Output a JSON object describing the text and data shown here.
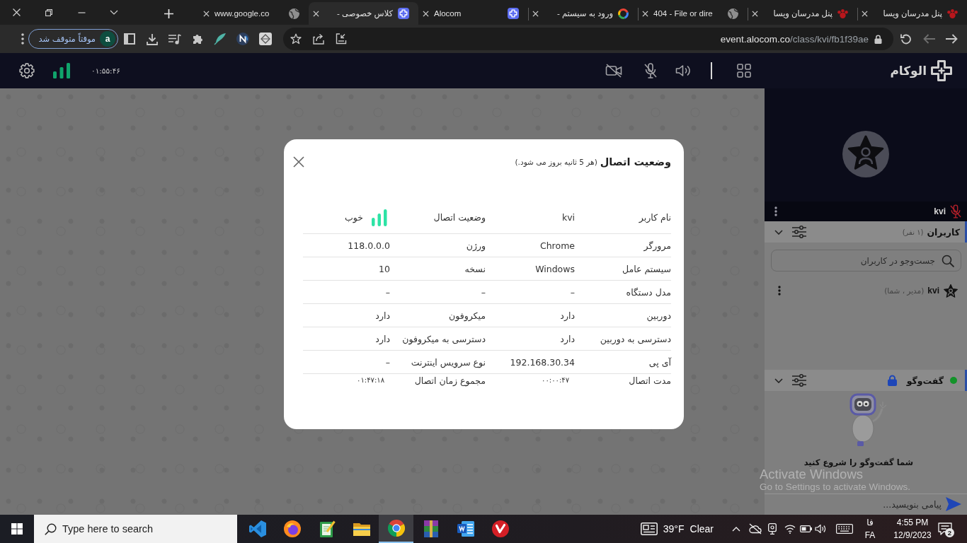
{
  "browser": {
    "tabs": [
      {
        "title": "پنل مدرسان ویسا",
        "kind": "paw",
        "selected": false
      },
      {
        "title": "پنل مدرسان ویسا",
        "kind": "paw",
        "selected": false
      },
      {
        "title": "404 - File or dire",
        "kind": "globe",
        "selected": false
      },
      {
        "title": "ورود به سیستم -",
        "kind": "ring",
        "selected": false
      },
      {
        "title": "Alocom",
        "kind": "logo",
        "selected": false
      },
      {
        "title": "کلاس خصوصی -",
        "kind": "logo",
        "selected": true
      },
      {
        "title": "www.google.co",
        "kind": "globe",
        "selected": false
      }
    ],
    "profile": {
      "avatar": "a",
      "label": "موقتاً متوقف شد"
    },
    "address": {
      "host": "event.alocom.co",
      "path": "/class/kvi/fb1f39ae"
    }
  },
  "app_header": {
    "elapsed": "۰۱:۵۵:۴۶",
    "camera_on": false,
    "mic_on": false,
    "logo": "الوکام"
  },
  "dialog": {
    "title": "وضعیت اتصال",
    "subtitle": "(هر 5 ثانیه بروز می شود.)",
    "rows": [
      {
        "kind": "status",
        "cells": [
          "نام کاربر",
          "kvi",
          "وضعیت اتصال",
          "خوب"
        ]
      },
      {
        "kind": "plain",
        "cells": [
          "مرورگر",
          "Chrome",
          "ورژن",
          "118.0.0.0"
        ]
      },
      {
        "kind": "plain",
        "cells": [
          "سیستم عامل",
          "Windows",
          "نسخه",
          "10"
        ]
      },
      {
        "kind": "plain",
        "cells": [
          "مدل دستگاه",
          "–",
          "–",
          "–"
        ]
      },
      {
        "kind": "plain",
        "cells": [
          "دوربین",
          "دارد",
          "میکروفون",
          "دارد"
        ]
      },
      {
        "kind": "plain",
        "cells": [
          "دسترسی به دوربین",
          "دارد",
          "دسترسی به میکروفون",
          "دارد"
        ]
      },
      {
        "kind": "plain",
        "cells": [
          "آی پی",
          "192.168.30.34",
          "نوع سرویس اینترنت",
          "–"
        ]
      },
      {
        "kind": "time",
        "cells": [
          "مدت اتصال",
          "۰۰:۰۰:۴۷",
          "مجموع زمان اتصال",
          "۰۱:۴۷:۱۸"
        ]
      }
    ]
  },
  "sidebar": {
    "tile": {
      "name": "kvi",
      "mic_on": false
    },
    "users": {
      "title": "کاربران",
      "count": "(۱ نفر)",
      "search": {
        "placeholder": "جست‌وجو در کاربران"
      },
      "items": [
        {
          "name": "kvi",
          "role": "(مدیر ، شما)"
        }
      ]
    },
    "chat": {
      "title": "گفت‌وگو",
      "empty_text": "شما گفت‌وگو را شروع کنید",
      "input": {
        "placeholder": "پیامی بنویسید..."
      }
    }
  },
  "os_notice": {
    "title": "Activate Windows",
    "hint": "Go to Settings to activate Windows."
  },
  "taskbar": {
    "search": {
      "placeholder": "Type here to search"
    },
    "apps": [
      {
        "kind": "code",
        "selected": false
      },
      {
        "kind": "orb",
        "selected": false
      },
      {
        "kind": "notepad",
        "selected": false
      },
      {
        "kind": "folder",
        "selected": false
      },
      {
        "kind": "browser",
        "selected": true
      },
      {
        "kind": "books",
        "selected": false
      },
      {
        "kind": "document",
        "selected": false
      },
      {
        "kind": "swoosh",
        "selected": false
      }
    ],
    "weather": {
      "temperature": "39°F",
      "condition": "Clear"
    },
    "language": {
      "script": "فا",
      "code": "FA"
    },
    "clock": {
      "time": "4:55 PM",
      "date": "12/9/2023"
    },
    "notifications": {
      "count": "2"
    }
  }
}
